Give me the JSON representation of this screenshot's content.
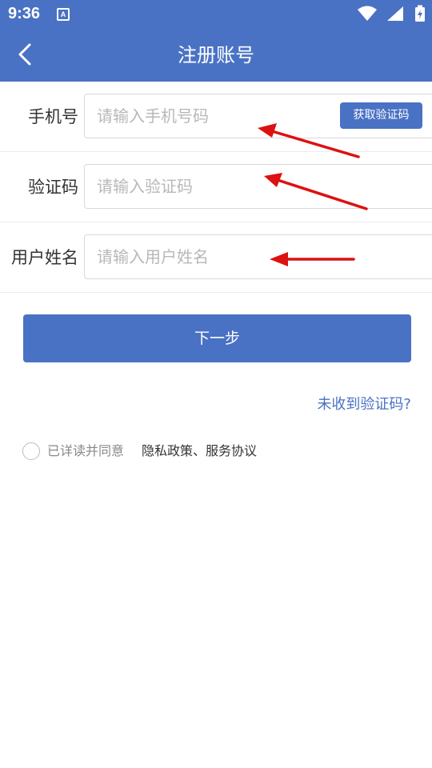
{
  "status_bar": {
    "time": "9:36",
    "notification_letter": "A",
    "icons": [
      "wifi-icon",
      "signal-icon",
      "battery-icon"
    ]
  },
  "header": {
    "title": "注册账号",
    "back_icon": "chevron-left-icon"
  },
  "form": {
    "phone": {
      "label": "手机号",
      "placeholder": "请输入手机号码",
      "value": ""
    },
    "get_code_label": "获取验证码",
    "code": {
      "label": "验证码",
      "placeholder": "请输入验证码",
      "value": ""
    },
    "username": {
      "label": "用户姓名",
      "placeholder": "请输入用户姓名",
      "value": ""
    }
  },
  "next_label": "下一步",
  "no_code_link": "未收到验证码?",
  "agreement": {
    "checked": false,
    "text": "已详读并同意",
    "links": "隐私政策、服务协议"
  },
  "colors": {
    "primary": "#4a72c4",
    "annotation_arrow": "#dd1111"
  }
}
